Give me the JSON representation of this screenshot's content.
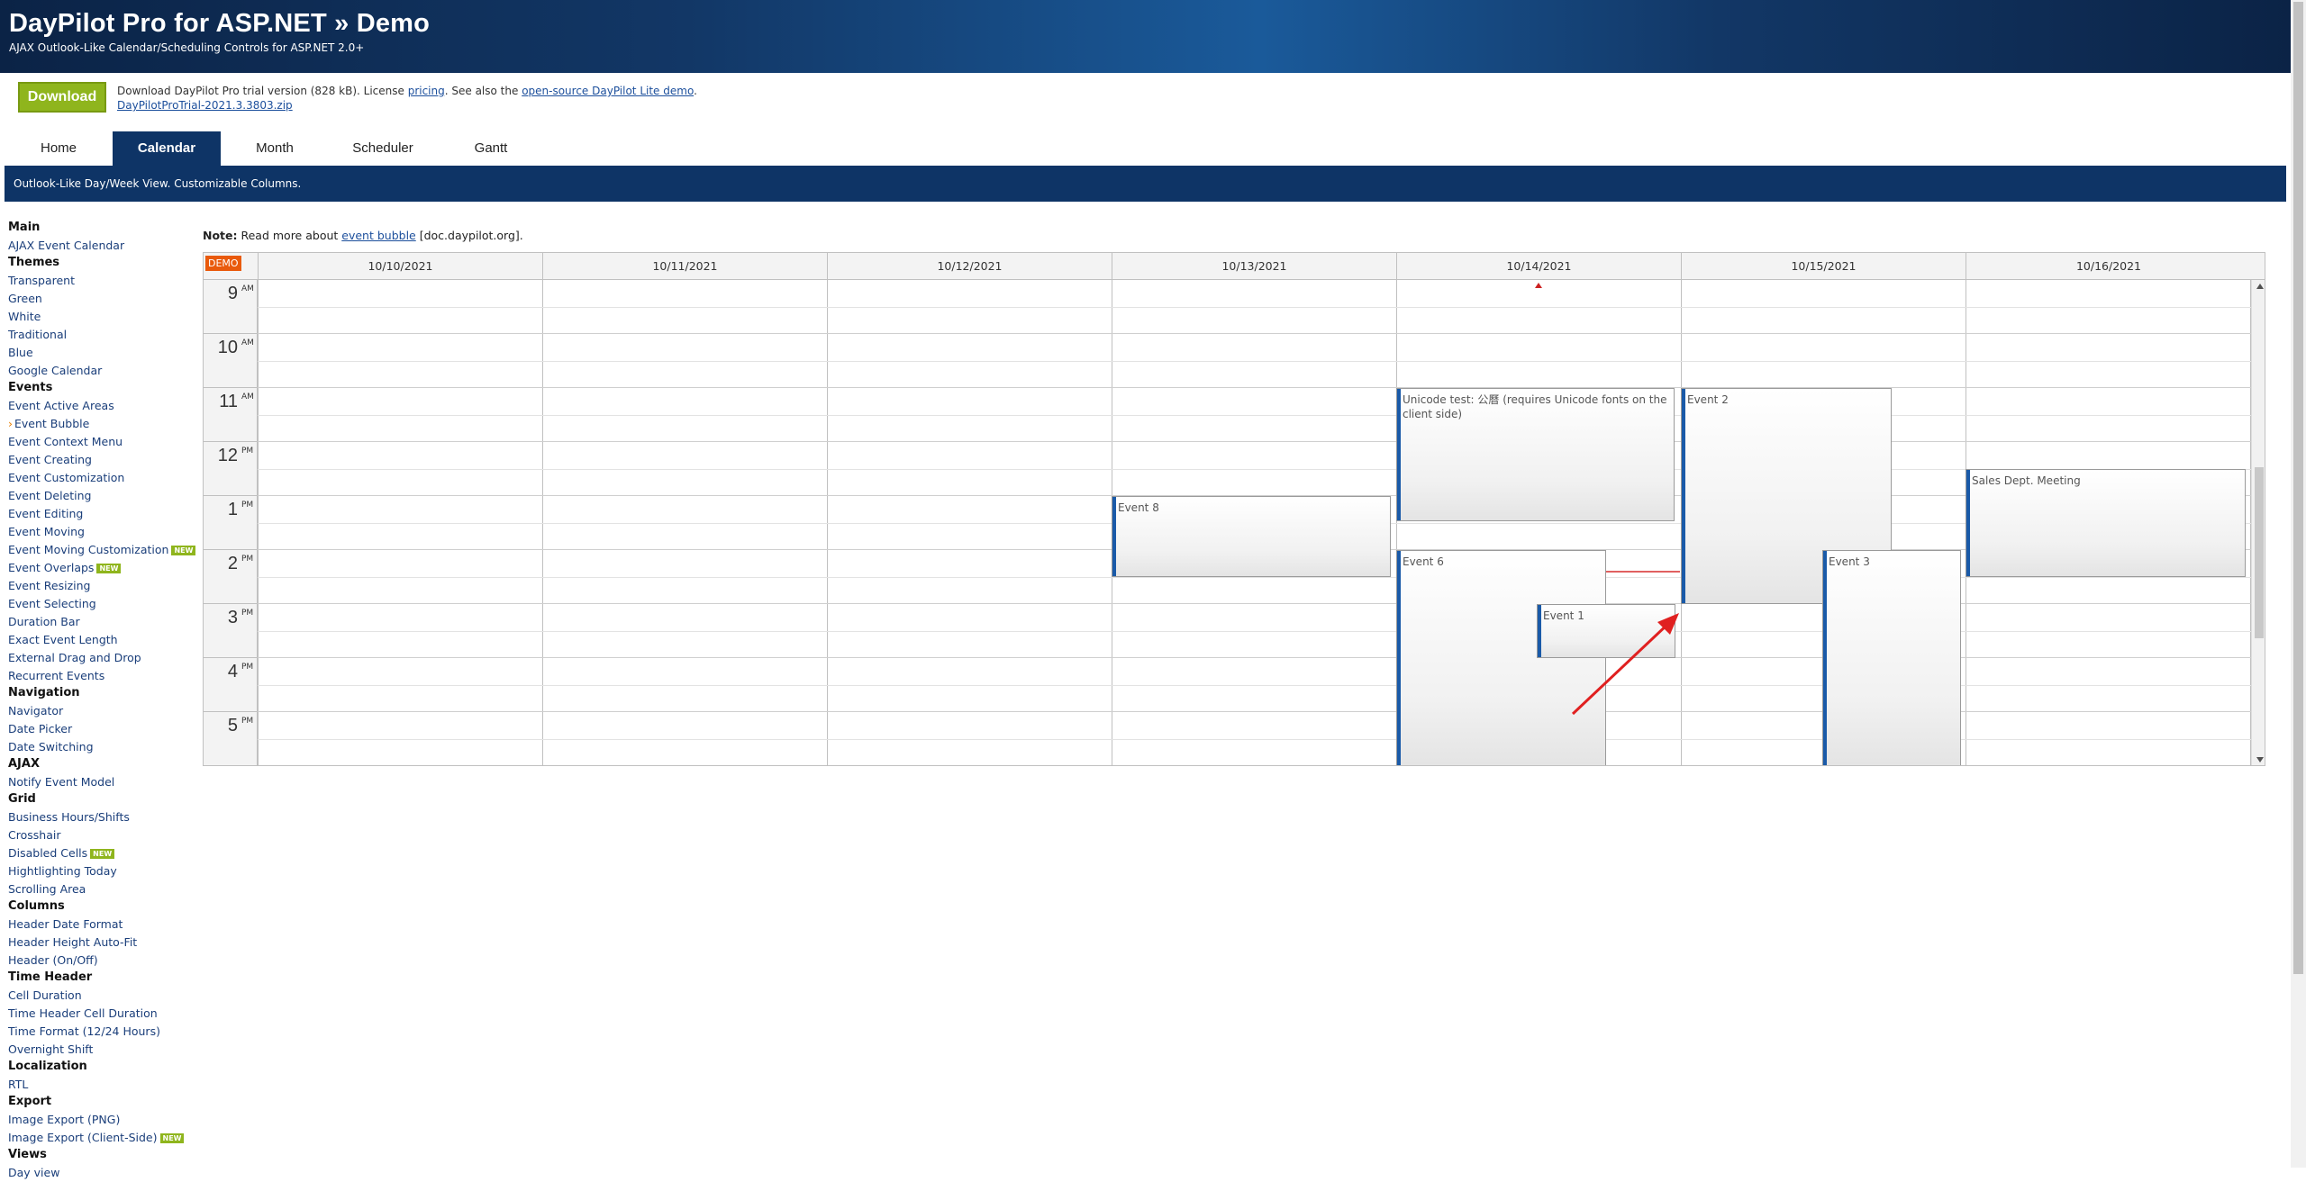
{
  "header": {
    "title": "DayPilot Pro for ASP.NET » Demo",
    "subtitle": "AJAX Outlook-Like Calendar/Scheduling Controls for ASP.NET 2.0+"
  },
  "download": {
    "button_label": "Download",
    "text_prefix": "Download DayPilot Pro trial version (828 kB). License ",
    "pricing_link": "pricing",
    "text_middle": ". See also the ",
    "lite_link": "open-source DayPilot Lite demo",
    "text_suffix": ".",
    "zip_link": "DayPilotProTrial-2021.3.3803.zip"
  },
  "tabs": [
    {
      "label": "Home",
      "active": false
    },
    {
      "label": "Calendar",
      "active": true
    },
    {
      "label": "Month",
      "active": false
    },
    {
      "label": "Scheduler",
      "active": false
    },
    {
      "label": "Gantt",
      "active": false
    }
  ],
  "tab_description": "Outlook-Like Day/Week View. Customizable Columns.",
  "sidebar": [
    {
      "type": "section",
      "label": "Main"
    },
    {
      "type": "item",
      "label": "AJAX Event Calendar"
    },
    {
      "type": "section",
      "label": "Themes"
    },
    {
      "type": "item",
      "label": "Transparent"
    },
    {
      "type": "item",
      "label": "Green"
    },
    {
      "type": "item",
      "label": "White"
    },
    {
      "type": "item",
      "label": "Traditional"
    },
    {
      "type": "item",
      "label": "Blue"
    },
    {
      "type": "item",
      "label": "Google Calendar"
    },
    {
      "type": "section",
      "label": "Events"
    },
    {
      "type": "item",
      "label": "Event Active Areas"
    },
    {
      "type": "item",
      "label": "Event Bubble",
      "current": true
    },
    {
      "type": "item",
      "label": "Event Context Menu"
    },
    {
      "type": "item",
      "label": "Event Creating"
    },
    {
      "type": "item",
      "label": "Event Customization"
    },
    {
      "type": "item",
      "label": "Event Deleting"
    },
    {
      "type": "item",
      "label": "Event Editing"
    },
    {
      "type": "item",
      "label": "Event Moving"
    },
    {
      "type": "item",
      "label": "Event Moving Customization",
      "badge": "NEW"
    },
    {
      "type": "item",
      "label": "Event Overlaps",
      "badge": "NEW"
    },
    {
      "type": "item",
      "label": "Event Resizing"
    },
    {
      "type": "item",
      "label": "Event Selecting"
    },
    {
      "type": "item",
      "label": "Duration Bar"
    },
    {
      "type": "item",
      "label": "Exact Event Length"
    },
    {
      "type": "item",
      "label": "External Drag and Drop"
    },
    {
      "type": "item",
      "label": "Recurrent Events"
    },
    {
      "type": "section",
      "label": "Navigation"
    },
    {
      "type": "item",
      "label": "Navigator"
    },
    {
      "type": "item",
      "label": "Date Picker"
    },
    {
      "type": "item",
      "label": "Date Switching"
    },
    {
      "type": "section",
      "label": "AJAX"
    },
    {
      "type": "item",
      "label": "Notify Event Model"
    },
    {
      "type": "section",
      "label": "Grid"
    },
    {
      "type": "item",
      "label": "Business Hours/Shifts"
    },
    {
      "type": "item",
      "label": "Crosshair"
    },
    {
      "type": "item",
      "label": "Disabled Cells",
      "badge": "NEW"
    },
    {
      "type": "item",
      "label": "Hightlighting Today"
    },
    {
      "type": "item",
      "label": "Scrolling Area"
    },
    {
      "type": "section",
      "label": "Columns"
    },
    {
      "type": "item",
      "label": "Header Date Format"
    },
    {
      "type": "item",
      "label": "Header Height Auto-Fit"
    },
    {
      "type": "item",
      "label": "Header (On/Off)"
    },
    {
      "type": "section",
      "label": "Time Header"
    },
    {
      "type": "item",
      "label": "Cell Duration"
    },
    {
      "type": "item",
      "label": "Time Header Cell Duration"
    },
    {
      "type": "item",
      "label": "Time Format (12/24 Hours)"
    },
    {
      "type": "item",
      "label": "Overnight Shift"
    },
    {
      "type": "section",
      "label": "Localization"
    },
    {
      "type": "item",
      "label": "RTL"
    },
    {
      "type": "section",
      "label": "Export"
    },
    {
      "type": "item",
      "label": "Image Export (PNG)"
    },
    {
      "type": "item",
      "label": "Image Export (Client-Side)",
      "badge": "NEW"
    },
    {
      "type": "section",
      "label": "Views"
    },
    {
      "type": "item",
      "label": "Day view"
    }
  ],
  "note": {
    "bold": "Note:",
    "text_before": " Read more about ",
    "link": "event bubble",
    "text_after": " [doc.daypilot.org]."
  },
  "calendar": {
    "demo_badge": "DEMO",
    "columns": [
      "10/10/2021",
      "10/11/2021",
      "10/12/2021",
      "10/13/2021",
      "10/14/2021",
      "10/15/2021",
      "10/16/2021"
    ],
    "today_column": 4,
    "hours": [
      {
        "h": "9",
        "ap": "AM"
      },
      {
        "h": "10",
        "ap": "AM"
      },
      {
        "h": "11",
        "ap": "AM"
      },
      {
        "h": "12",
        "ap": "PM"
      },
      {
        "h": "1",
        "ap": "PM"
      },
      {
        "h": "2",
        "ap": "PM"
      },
      {
        "h": "3",
        "ap": "PM"
      },
      {
        "h": "4",
        "ap": "PM"
      },
      {
        "h": "5",
        "ap": "PM"
      }
    ],
    "events": [
      {
        "text": "Unicode test: 公曆 (requires Unicode fonts on the client side)"
      },
      {
        "text": "Event 2"
      },
      {
        "text": "Sales Dept. Meeting"
      },
      {
        "text": "Event 8"
      },
      {
        "text": "Event 6"
      },
      {
        "text": "Event 3"
      },
      {
        "text": "Event 1"
      }
    ],
    "accent_color": "#1a5aa8"
  },
  "colors": {
    "header_bg": "#0e3466",
    "download_green": "#8fb51d",
    "demo_orange": "#e95a0c",
    "arrow_red": "#e02020"
  }
}
